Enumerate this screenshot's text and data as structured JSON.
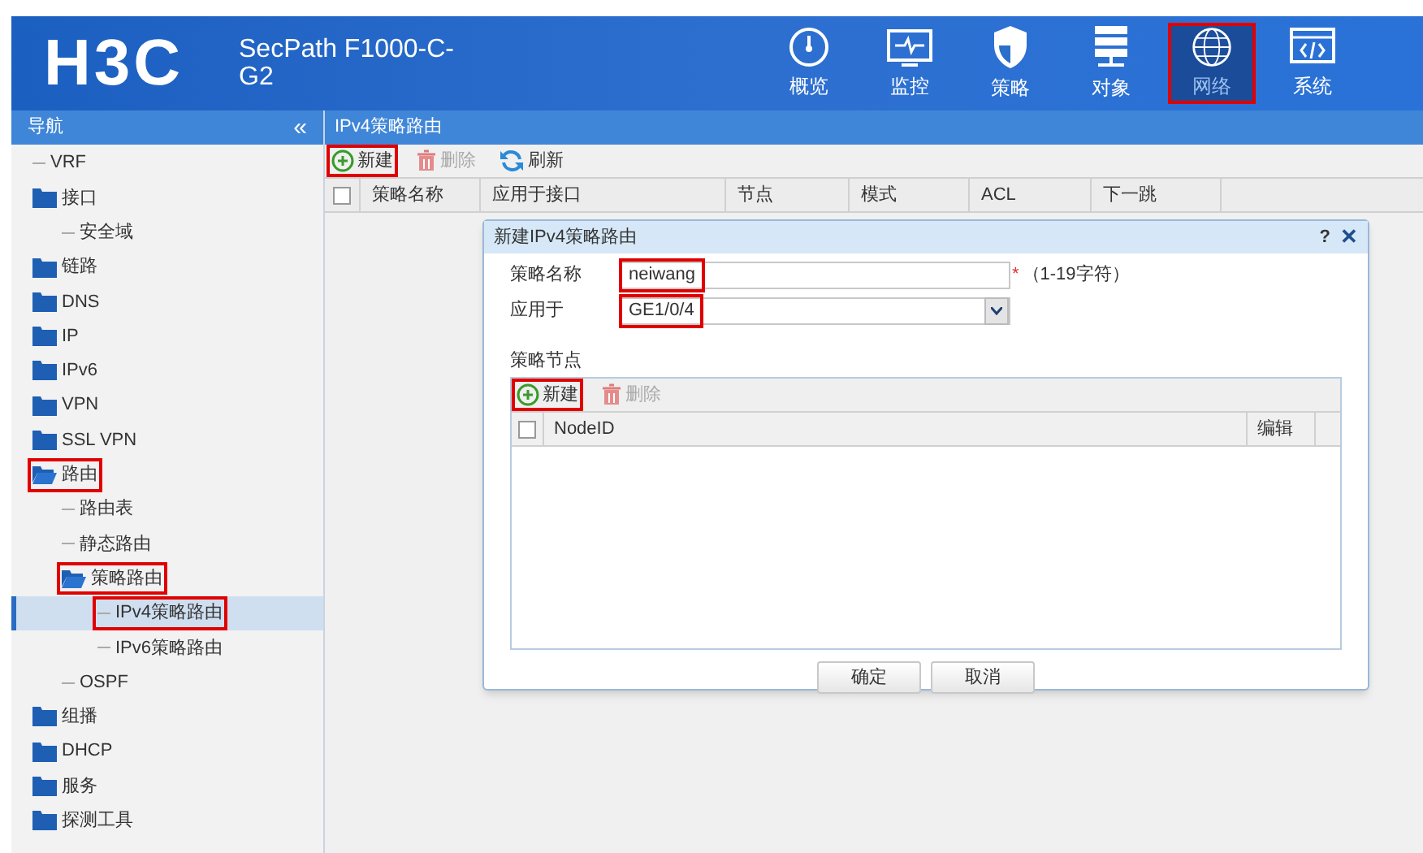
{
  "header": {
    "logo": "H3C",
    "product": "SecPath F1000-C-G2",
    "nav": [
      {
        "label": "概览",
        "selected": false,
        "highlighted": false
      },
      {
        "label": "监控",
        "selected": false,
        "highlighted": false
      },
      {
        "label": "策略",
        "selected": false,
        "highlighted": false
      },
      {
        "label": "对象",
        "selected": false,
        "highlighted": false
      },
      {
        "label": "网络",
        "selected": true,
        "highlighted": true
      },
      {
        "label": "系统",
        "selected": false,
        "highlighted": false
      }
    ]
  },
  "sidebar": {
    "title": "导航",
    "collapse": "«",
    "items": [
      {
        "label": "VRF",
        "kind": "leaf",
        "selected": false,
        "highlighted": false
      },
      {
        "label": "接口",
        "kind": "folder",
        "expanded": false,
        "selected": false,
        "highlighted": false,
        "children": [
          {
            "label": "安全域",
            "kind": "leaf",
            "selected": false,
            "highlighted": false
          }
        ]
      },
      {
        "label": "链路",
        "kind": "folder",
        "expanded": false,
        "selected": false,
        "highlighted": false
      },
      {
        "label": "DNS",
        "kind": "folder",
        "expanded": false,
        "selected": false,
        "highlighted": false
      },
      {
        "label": "IP",
        "kind": "folder",
        "expanded": false,
        "selected": false,
        "highlighted": false
      },
      {
        "label": "IPv6",
        "kind": "folder",
        "expanded": false,
        "selected": false,
        "highlighted": false
      },
      {
        "label": "VPN",
        "kind": "folder",
        "expanded": false,
        "selected": false,
        "highlighted": false
      },
      {
        "label": "SSL VPN",
        "kind": "folder",
        "expanded": false,
        "selected": false,
        "highlighted": false
      },
      {
        "label": "路由",
        "kind": "folder",
        "expanded": true,
        "selected": false,
        "highlighted": true,
        "children": [
          {
            "label": "路由表",
            "kind": "leaf",
            "selected": false,
            "highlighted": false
          },
          {
            "label": "静态路由",
            "kind": "leaf",
            "selected": false,
            "highlighted": false
          },
          {
            "label": "策略路由",
            "kind": "folder",
            "expanded": true,
            "selected": false,
            "highlighted": true,
            "children": [
              {
                "label": "IPv4策略路由",
                "kind": "leaf",
                "selected": true,
                "highlighted": true
              },
              {
                "label": "IPv6策略路由",
                "kind": "leaf",
                "selected": false,
                "highlighted": false
              }
            ]
          },
          {
            "label": "OSPF",
            "kind": "leaf",
            "selected": false,
            "highlighted": false
          }
        ]
      },
      {
        "label": "组播",
        "kind": "folder",
        "expanded": false,
        "selected": false,
        "highlighted": false
      },
      {
        "label": "DHCP",
        "kind": "folder",
        "expanded": false,
        "selected": false,
        "highlighted": false
      },
      {
        "label": "服务",
        "kind": "folder",
        "expanded": false,
        "selected": false,
        "highlighted": false
      },
      {
        "label": "探测工具",
        "kind": "folder",
        "expanded": false,
        "selected": false,
        "highlighted": false
      }
    ]
  },
  "main": {
    "title": "IPv4策略路由",
    "toolbar": [
      {
        "label": "新建",
        "kind": "add",
        "disabled": false,
        "highlighted": true
      },
      {
        "label": "删除",
        "kind": "delete",
        "disabled": true,
        "highlighted": false
      },
      {
        "label": "刷新",
        "kind": "refresh",
        "disabled": false,
        "highlighted": false
      }
    ],
    "table": {
      "select_all": false,
      "columns": [
        "策略名称",
        "应用于接口",
        "节点",
        "模式",
        "ACL",
        "下一跳"
      ]
    }
  },
  "dialog": {
    "title": "新建IPv4策略路由",
    "help": "?",
    "close": "✕",
    "fields": [
      {
        "label": "策略名称",
        "kind": "text",
        "value": "neiwang",
        "required_mark": "*",
        "hint": "（1-19字符）",
        "highlighted": true
      },
      {
        "label": "应用于",
        "kind": "select",
        "value": "GE1/0/4",
        "highlighted": true
      }
    ],
    "section": "策略节点",
    "toolbar": [
      {
        "label": "新建",
        "kind": "add",
        "disabled": false,
        "highlighted": true
      },
      {
        "label": "删除",
        "kind": "delete",
        "disabled": true,
        "highlighted": false
      }
    ],
    "table": {
      "select_all": false,
      "columns": [
        "NodeID",
        "编辑"
      ]
    },
    "buttons": [
      "确定",
      "取消"
    ]
  }
}
